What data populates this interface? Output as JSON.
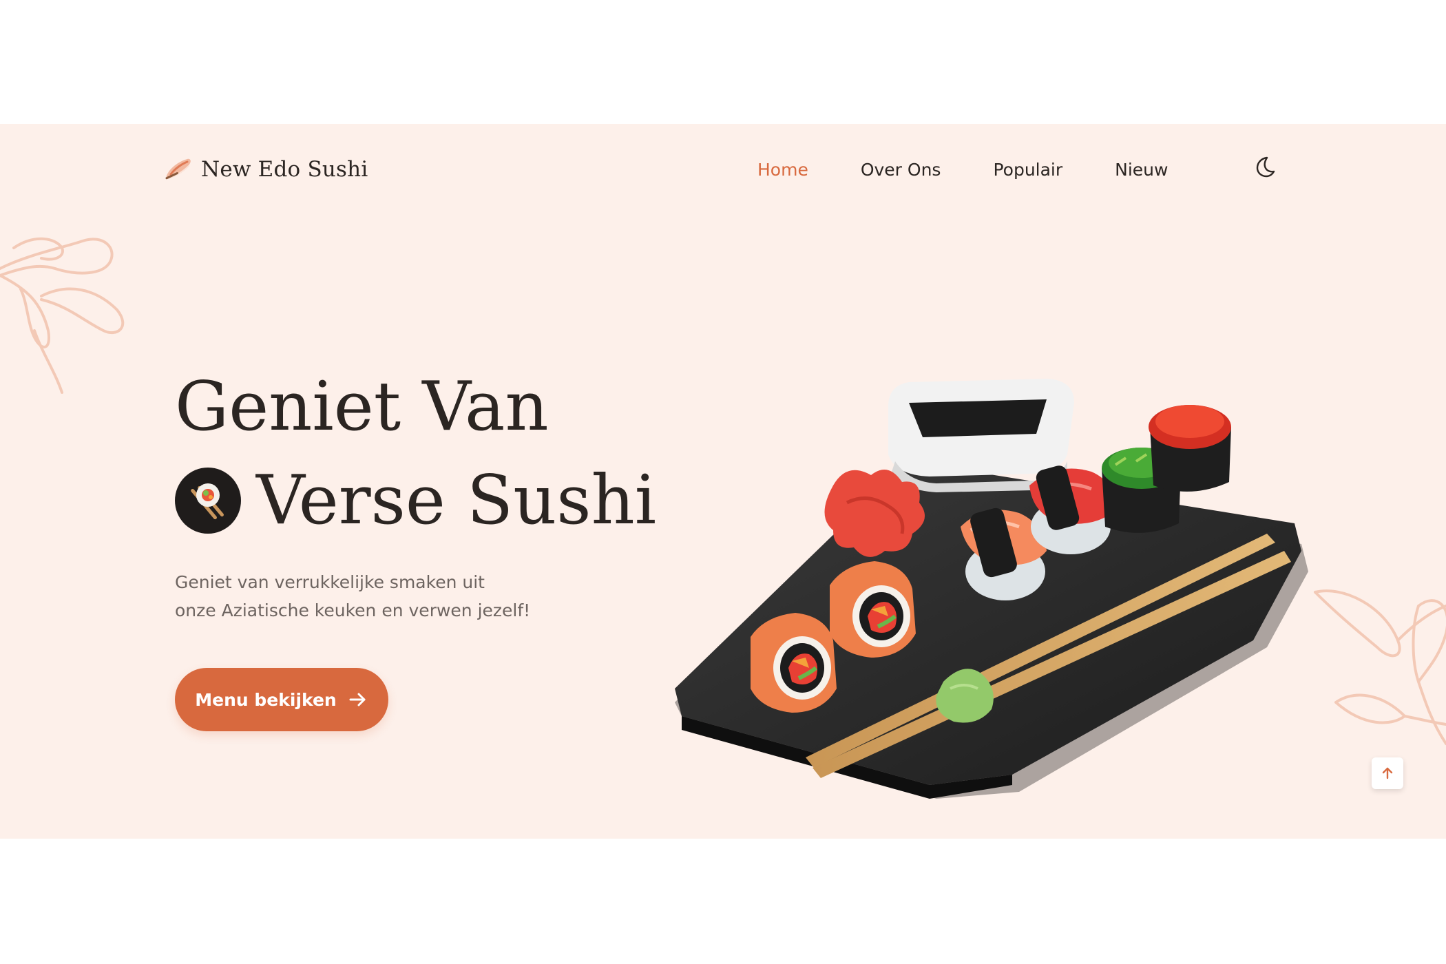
{
  "brand": {
    "name": "New Edo Sushi",
    "icon": "sushi-logo-icon"
  },
  "nav": {
    "items": [
      {
        "label": "Home",
        "active": true
      },
      {
        "label": "Over Ons",
        "active": false
      },
      {
        "label": "Populair",
        "active": false
      },
      {
        "label": "Nieuw",
        "active": false
      }
    ],
    "theme_toggle_icon": "moon-icon"
  },
  "hero": {
    "title_line1": "Geniet Van",
    "title_line2": "Verse Sushi",
    "description_line1": "Geniet van verrukkelijke smaken uit",
    "description_line2": "onze Aziatische keuken en verwen jezelf!",
    "cta_label": "Menu bekijken",
    "cta_icon": "arrow-right-icon"
  },
  "scroll_top_icon": "arrow-up-icon",
  "colors": {
    "background": "#fdf0ea",
    "accent": "#d8693e",
    "text": "#2b2522",
    "muted_text": "#6d6460"
  }
}
